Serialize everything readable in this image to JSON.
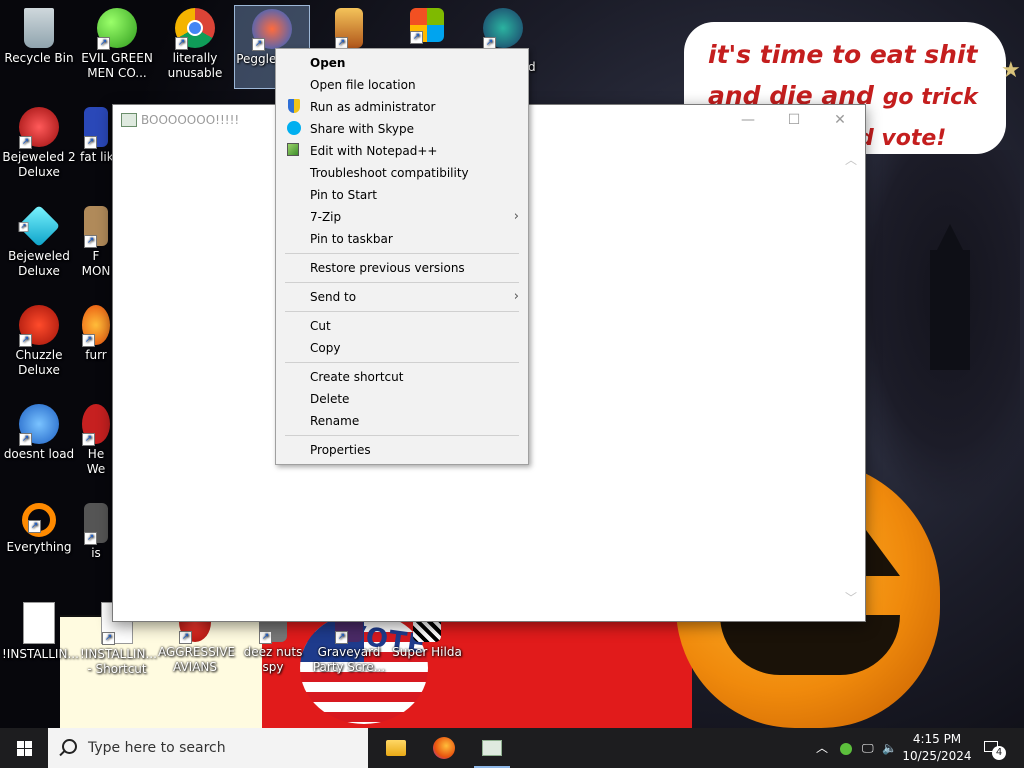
{
  "wallpaper": {
    "bubble_line1": "it's time to eat shit",
    "bubble_line2a": "and die and",
    "bubble_line2b": "go trick",
    "bubble_line3": "d vote!",
    "vote_text": "VOTE"
  },
  "desktop_icons": [
    {
      "id": "recycle-bin",
      "label": "Recycle Bin",
      "icon": "recycle-bin-icon"
    },
    {
      "id": "evil-green",
      "label": "EVIL GREEN MEN CO...",
      "icon": "green-men-icon"
    },
    {
      "id": "literally-unusable",
      "label": "literally unusable",
      "icon": "chrome-icon"
    },
    {
      "id": "peggle",
      "label": "Peggle Delu",
      "icon": "peggle-icon"
    },
    {
      "id": "bejeweled2",
      "label": "Bejeweled 2 Deluxe",
      "icon": "bejeweled2-icon"
    },
    {
      "id": "fat-like",
      "label": "fat like",
      "icon": "app-icon"
    },
    {
      "id": "bejeweled",
      "label": "Bejeweled Deluxe",
      "icon": "diamond-icon"
    },
    {
      "id": "f-mon",
      "label": "F MON",
      "icon": "app-icon"
    },
    {
      "id": "chuzzle",
      "label": "Chuzzle Deluxe",
      "icon": "chuzzle-icon"
    },
    {
      "id": "furr",
      "label": "furr",
      "icon": "firefox-icon"
    },
    {
      "id": "doesnt-load",
      "label": "doesnt load",
      "icon": "thunderbird-icon"
    },
    {
      "id": "he-we",
      "label": "He We",
      "icon": "app-icon"
    },
    {
      "id": "everything",
      "label": "Everything",
      "icon": "search-magnifier-icon"
    },
    {
      "id": "is",
      "label": "is",
      "icon": "app-icon"
    },
    {
      "id": "installing",
      "label": "!INSTALLIN...",
      "icon": "document-icon"
    },
    {
      "id": "installing-shortcut",
      "label": "!INSTALLIN... - Shortcut",
      "icon": "document-icon"
    },
    {
      "id": "aggressive-avians",
      "label": "AGGRESSIVE AVIANS",
      "icon": "angry-bird-icon"
    },
    {
      "id": "deez-nuts",
      "label": "deez nuts spy",
      "icon": "app-icon"
    },
    {
      "id": "graveyard",
      "label": "Graveyard Party Scre...",
      "icon": "app-icon"
    },
    {
      "id": "super-hilda",
      "label": "Super Hilda",
      "icon": "app-icon"
    },
    {
      "id": "top-app-1",
      "label": "",
      "icon": "app-icon"
    },
    {
      "id": "top-app-2",
      "label": "",
      "icon": "windows-logo-icon"
    },
    {
      "id": "top-app-3",
      "label": "d",
      "icon": "character-icon"
    }
  ],
  "window": {
    "title": "BOOOOOOO!!!!!",
    "minimize": "—",
    "maximize": "☐",
    "close": "✕",
    "scroll_up": "︿",
    "scroll_down": "﹀"
  },
  "context_menu": {
    "groups": [
      [
        {
          "label": "Open",
          "bold": true,
          "icon": ""
        },
        {
          "label": "Open file location",
          "icon": ""
        },
        {
          "label": "Run as administrator",
          "icon": "uac-shield-icon"
        },
        {
          "label": "Share with Skype",
          "icon": "skype-icon"
        },
        {
          "label": "Edit with Notepad++",
          "icon": "notepadpp-icon"
        },
        {
          "label": "Troubleshoot compatibility",
          "icon": ""
        },
        {
          "label": "Pin to Start",
          "icon": ""
        },
        {
          "label": "7-Zip",
          "icon": "",
          "submenu": true
        },
        {
          "label": "Pin to taskbar",
          "icon": ""
        }
      ],
      [
        {
          "label": "Restore previous versions",
          "icon": ""
        }
      ],
      [
        {
          "label": "Send to",
          "icon": "",
          "submenu": true
        }
      ],
      [
        {
          "label": "Cut",
          "icon": ""
        },
        {
          "label": "Copy",
          "icon": ""
        }
      ],
      [
        {
          "label": "Create shortcut",
          "icon": ""
        },
        {
          "label": "Delete",
          "icon": ""
        },
        {
          "label": "Rename",
          "icon": ""
        }
      ],
      [
        {
          "label": "Properties",
          "icon": ""
        }
      ]
    ],
    "submenu_arrow": "›"
  },
  "taskbar": {
    "search_placeholder": "Type here to search",
    "apps": [
      "file-explorer-icon",
      "firefox-icon",
      "window-app-icon"
    ],
    "tray_chevron": "︿",
    "time": "4:15 PM",
    "date": "10/25/2024",
    "notification_count": "4"
  },
  "colors": {
    "bubble_text": "#c41e1e",
    "taskbar": "#1d1d1f",
    "menu_bg": "#f2f2f2"
  }
}
